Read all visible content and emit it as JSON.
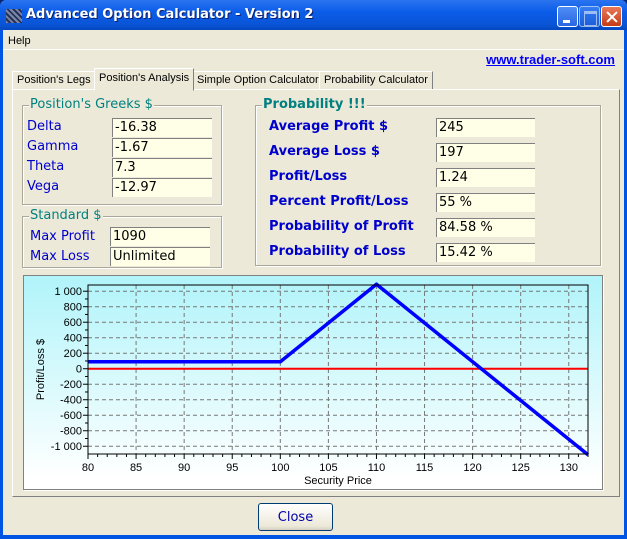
{
  "window": {
    "title": "Advanced Option Calculator - Version 2",
    "icon": "app-icon",
    "controls": [
      "minimize",
      "maximize",
      "close"
    ]
  },
  "menu": {
    "items": [
      {
        "label": "Help"
      }
    ]
  },
  "link": {
    "text": "www.trader-soft.com"
  },
  "tabs": [
    {
      "label": "Position's Legs",
      "active": false
    },
    {
      "label": "Position's Analysis",
      "active": true
    },
    {
      "label": "Simple Option Calculator",
      "active": false
    },
    {
      "label": "Probability Calculator",
      "active": false
    }
  ],
  "greeks": {
    "title": "Position's Greeks $",
    "rows": [
      {
        "label": "Delta",
        "value": "-16.38"
      },
      {
        "label": "Gamma",
        "value": "-1.67"
      },
      {
        "label": "Theta",
        "value": "7.3"
      },
      {
        "label": "Vega",
        "value": "-12.97"
      }
    ]
  },
  "standard": {
    "title": "Standard $",
    "rows": [
      {
        "label": "Max Profit",
        "value": "1090"
      },
      {
        "label": "Max Loss",
        "value": "Unlimited"
      }
    ]
  },
  "probability": {
    "title": "Probability !!!",
    "rows": [
      {
        "label": "Average Profit  $",
        "value": "245"
      },
      {
        "label": "Average Loss   $",
        "value": "197"
      },
      {
        "label": "Profit/Loss",
        "value": "1.24"
      },
      {
        "label": "Percent Profit/Loss",
        "value": "55 %"
      },
      {
        "label": "Probability of Profit",
        "value": "84.58 %"
      },
      {
        "label": "Probability of Loss",
        "value": "15.42 %"
      }
    ]
  },
  "buttons": {
    "close": "Close"
  },
  "chart_data": {
    "type": "line",
    "title": "",
    "xlabel": "Security Price",
    "ylabel": "Profit/Loss $",
    "xlim": [
      80,
      132
    ],
    "ylim": [
      -1100,
      1080
    ],
    "grid": true,
    "x_ticks": [
      80,
      85,
      90,
      95,
      100,
      105,
      110,
      115,
      120,
      125,
      130
    ],
    "y_ticks": [
      1000,
      800,
      600,
      400,
      200,
      0,
      -200,
      -400,
      -600,
      -800,
      -1000
    ],
    "y_tick_labels": [
      "1 000",
      "800",
      "600",
      "400",
      "200",
      "0",
      "-200",
      "-400",
      "-600",
      "-800",
      "-1 000"
    ],
    "series": [
      {
        "name": "Profit/Loss",
        "color": "#0000ff",
        "x": [
          80,
          100,
          110,
          132
        ],
        "y": [
          90,
          90,
          1090,
          -1110
        ]
      },
      {
        "name": "Zero line",
        "color": "#ff0000",
        "x": [
          80,
          132
        ],
        "y": [
          0,
          0
        ]
      }
    ]
  }
}
